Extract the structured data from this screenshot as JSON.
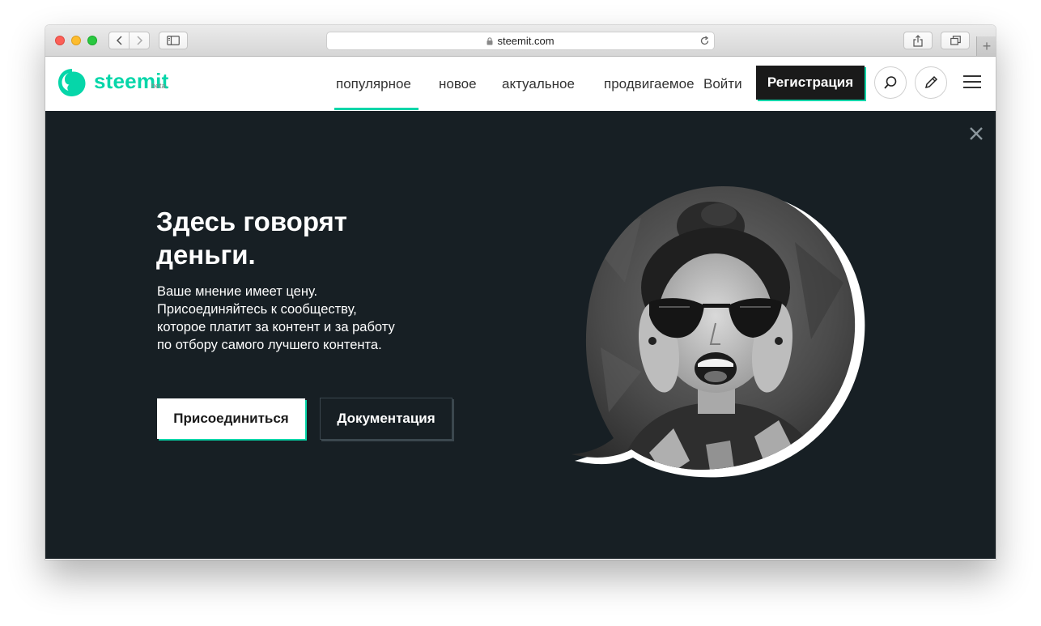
{
  "browser": {
    "url": "steemit.com",
    "new_tab": "+"
  },
  "header": {
    "logo_text": "steemit",
    "logo_badge": "beta",
    "nav": [
      {
        "label": "популярное",
        "active": true
      },
      {
        "label": "новое",
        "active": false
      },
      {
        "label": "актуальное",
        "active": false
      },
      {
        "label": "продвигаемое",
        "active": false
      }
    ],
    "login_label": "Войти",
    "signup_label": "Регистрация",
    "icons": [
      "search-icon",
      "pencil-icon",
      "menu-icon"
    ]
  },
  "hero": {
    "title": "Здесь говорят деньги.",
    "text": "Ваше мнение имеет цену. Присоединяйтесь к сообществу, которое платит за контент и за работу по отбору самого лучшего контента.",
    "primary_button": "Присоединиться",
    "secondary_button": "Документация"
  },
  "colors": {
    "accent": "#06d6a9",
    "hero_bg": "#171f24",
    "dark_button": "#1a1a1a"
  }
}
